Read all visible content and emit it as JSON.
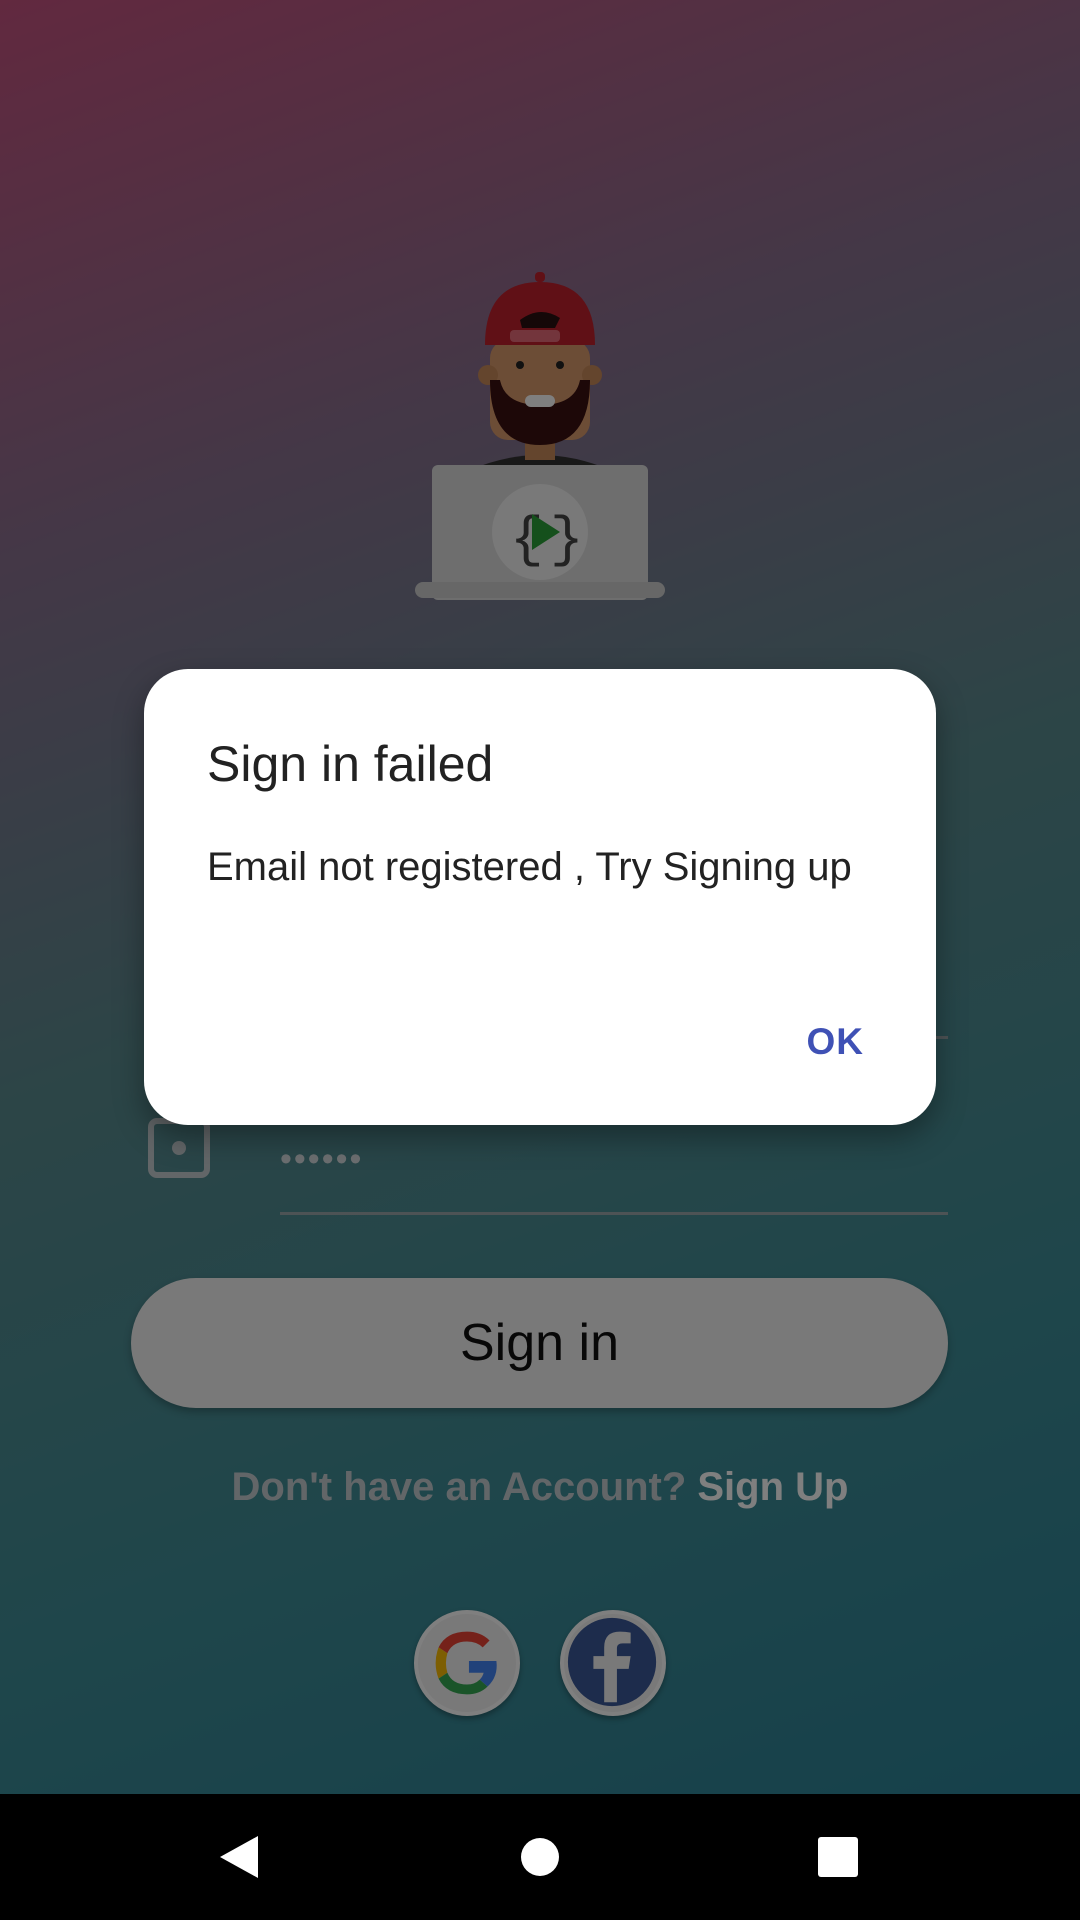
{
  "form": {
    "password_mask": "••••••",
    "signin_label": "Sign in",
    "signup_prompt": "Don't have an Account? ",
    "signup_link": "Sign Up"
  },
  "dialog": {
    "title": "Sign in failed",
    "message": "Email not registered , Try Signing up",
    "ok_label": "OK"
  },
  "icons": {
    "google": "google-icon",
    "facebook": "facebook-icon",
    "lock": "lock-icon",
    "back": "back-icon",
    "home": "home-icon",
    "recent": "recent-apps-icon"
  },
  "colors": {
    "accent": "#3f51b5",
    "facebook": "#3b5998"
  }
}
